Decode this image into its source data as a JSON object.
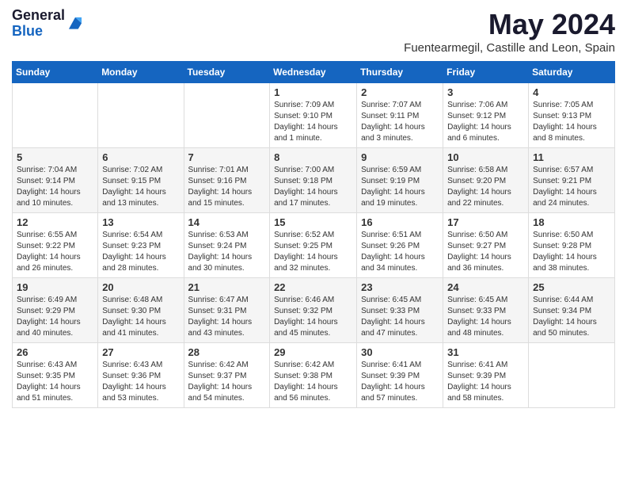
{
  "header": {
    "logo_general": "General",
    "logo_blue": "Blue",
    "month_title": "May 2024",
    "location": "Fuentearmegil, Castille and Leon, Spain"
  },
  "days_of_week": [
    "Sunday",
    "Monday",
    "Tuesday",
    "Wednesday",
    "Thursday",
    "Friday",
    "Saturday"
  ],
  "weeks": [
    [
      {
        "day": "",
        "info": ""
      },
      {
        "day": "",
        "info": ""
      },
      {
        "day": "",
        "info": ""
      },
      {
        "day": "1",
        "info": "Sunrise: 7:09 AM\nSunset: 9:10 PM\nDaylight: 14 hours and 1 minute."
      },
      {
        "day": "2",
        "info": "Sunrise: 7:07 AM\nSunset: 9:11 PM\nDaylight: 14 hours and 3 minutes."
      },
      {
        "day": "3",
        "info": "Sunrise: 7:06 AM\nSunset: 9:12 PM\nDaylight: 14 hours and 6 minutes."
      },
      {
        "day": "4",
        "info": "Sunrise: 7:05 AM\nSunset: 9:13 PM\nDaylight: 14 hours and 8 minutes."
      }
    ],
    [
      {
        "day": "5",
        "info": "Sunrise: 7:04 AM\nSunset: 9:14 PM\nDaylight: 14 hours and 10 minutes."
      },
      {
        "day": "6",
        "info": "Sunrise: 7:02 AM\nSunset: 9:15 PM\nDaylight: 14 hours and 13 minutes."
      },
      {
        "day": "7",
        "info": "Sunrise: 7:01 AM\nSunset: 9:16 PM\nDaylight: 14 hours and 15 minutes."
      },
      {
        "day": "8",
        "info": "Sunrise: 7:00 AM\nSunset: 9:18 PM\nDaylight: 14 hours and 17 minutes."
      },
      {
        "day": "9",
        "info": "Sunrise: 6:59 AM\nSunset: 9:19 PM\nDaylight: 14 hours and 19 minutes."
      },
      {
        "day": "10",
        "info": "Sunrise: 6:58 AM\nSunset: 9:20 PM\nDaylight: 14 hours and 22 minutes."
      },
      {
        "day": "11",
        "info": "Sunrise: 6:57 AM\nSunset: 9:21 PM\nDaylight: 14 hours and 24 minutes."
      }
    ],
    [
      {
        "day": "12",
        "info": "Sunrise: 6:55 AM\nSunset: 9:22 PM\nDaylight: 14 hours and 26 minutes."
      },
      {
        "day": "13",
        "info": "Sunrise: 6:54 AM\nSunset: 9:23 PM\nDaylight: 14 hours and 28 minutes."
      },
      {
        "day": "14",
        "info": "Sunrise: 6:53 AM\nSunset: 9:24 PM\nDaylight: 14 hours and 30 minutes."
      },
      {
        "day": "15",
        "info": "Sunrise: 6:52 AM\nSunset: 9:25 PM\nDaylight: 14 hours and 32 minutes."
      },
      {
        "day": "16",
        "info": "Sunrise: 6:51 AM\nSunset: 9:26 PM\nDaylight: 14 hours and 34 minutes."
      },
      {
        "day": "17",
        "info": "Sunrise: 6:50 AM\nSunset: 9:27 PM\nDaylight: 14 hours and 36 minutes."
      },
      {
        "day": "18",
        "info": "Sunrise: 6:50 AM\nSunset: 9:28 PM\nDaylight: 14 hours and 38 minutes."
      }
    ],
    [
      {
        "day": "19",
        "info": "Sunrise: 6:49 AM\nSunset: 9:29 PM\nDaylight: 14 hours and 40 minutes."
      },
      {
        "day": "20",
        "info": "Sunrise: 6:48 AM\nSunset: 9:30 PM\nDaylight: 14 hours and 41 minutes."
      },
      {
        "day": "21",
        "info": "Sunrise: 6:47 AM\nSunset: 9:31 PM\nDaylight: 14 hours and 43 minutes."
      },
      {
        "day": "22",
        "info": "Sunrise: 6:46 AM\nSunset: 9:32 PM\nDaylight: 14 hours and 45 minutes."
      },
      {
        "day": "23",
        "info": "Sunrise: 6:45 AM\nSunset: 9:33 PM\nDaylight: 14 hours and 47 minutes."
      },
      {
        "day": "24",
        "info": "Sunrise: 6:45 AM\nSunset: 9:33 PM\nDaylight: 14 hours and 48 minutes."
      },
      {
        "day": "25",
        "info": "Sunrise: 6:44 AM\nSunset: 9:34 PM\nDaylight: 14 hours and 50 minutes."
      }
    ],
    [
      {
        "day": "26",
        "info": "Sunrise: 6:43 AM\nSunset: 9:35 PM\nDaylight: 14 hours and 51 minutes."
      },
      {
        "day": "27",
        "info": "Sunrise: 6:43 AM\nSunset: 9:36 PM\nDaylight: 14 hours and 53 minutes."
      },
      {
        "day": "28",
        "info": "Sunrise: 6:42 AM\nSunset: 9:37 PM\nDaylight: 14 hours and 54 minutes."
      },
      {
        "day": "29",
        "info": "Sunrise: 6:42 AM\nSunset: 9:38 PM\nDaylight: 14 hours and 56 minutes."
      },
      {
        "day": "30",
        "info": "Sunrise: 6:41 AM\nSunset: 9:39 PM\nDaylight: 14 hours and 57 minutes."
      },
      {
        "day": "31",
        "info": "Sunrise: 6:41 AM\nSunset: 9:39 PM\nDaylight: 14 hours and 58 minutes."
      },
      {
        "day": "",
        "info": ""
      }
    ]
  ]
}
